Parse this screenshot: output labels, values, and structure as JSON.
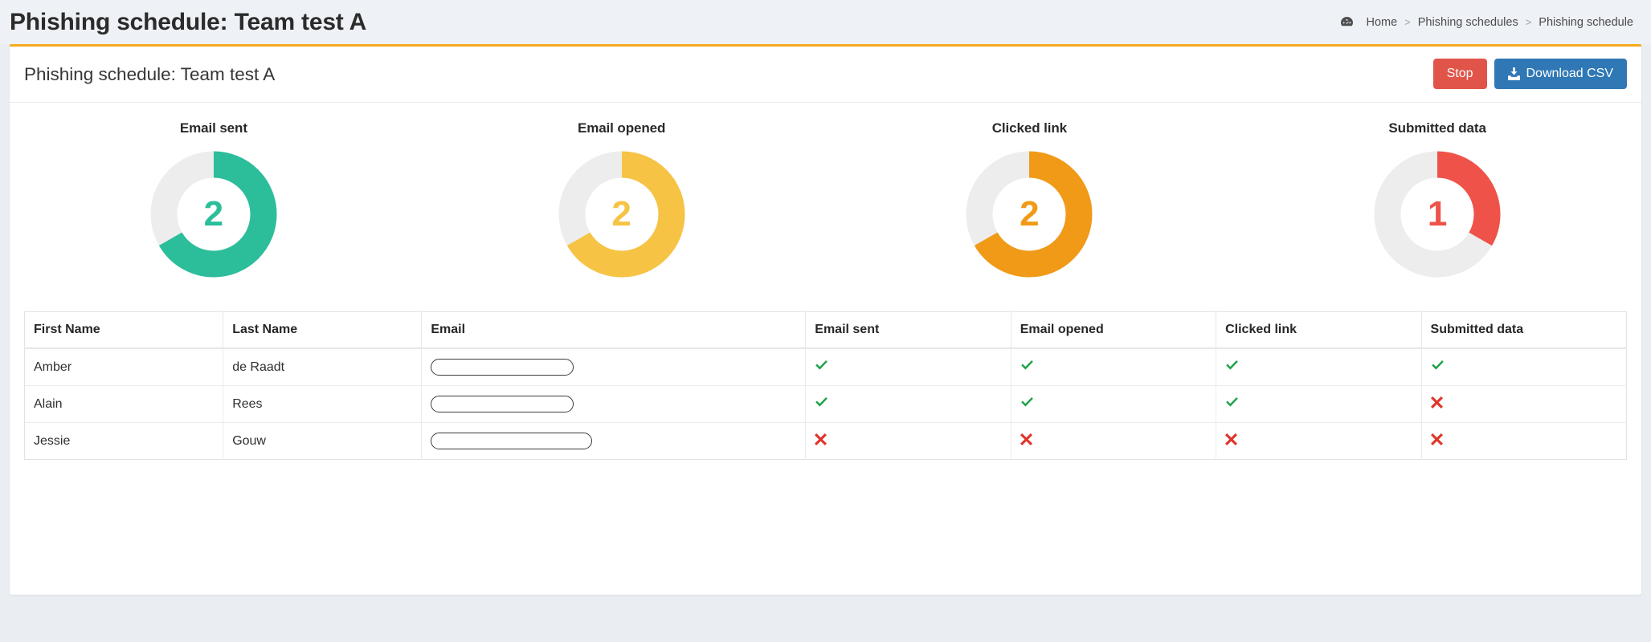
{
  "topbar": {
    "title": "Phishing schedule: Team test A",
    "breadcrumb": {
      "home_icon": "dashboard-icon",
      "items": [
        "Home",
        "Phishing schedules",
        "Phishing schedule"
      ],
      "separator": ">"
    }
  },
  "card": {
    "title": "Phishing schedule: Team test A",
    "accent_color": "#f4ab1c",
    "actions": {
      "stop_label": "Stop",
      "stop_color": "#e1544a",
      "download_label": "Download CSV",
      "download_color": "#2f77b5",
      "download_icon": "download-icon"
    }
  },
  "chart_data": [
    {
      "type": "pie",
      "title": "Email sent",
      "value": 2,
      "total": 3,
      "percent": 66.7,
      "color": "#2cbe9b",
      "track_color": "#ededed"
    },
    {
      "type": "pie",
      "title": "Email opened",
      "value": 2,
      "total": 3,
      "percent": 66.7,
      "color": "#f6c344",
      "track_color": "#ededed"
    },
    {
      "type": "pie",
      "title": "Clicked link",
      "value": 2,
      "total": 3,
      "percent": 66.7,
      "color": "#f09a18",
      "track_color": "#ededed"
    },
    {
      "type": "pie",
      "title": "Submitted data",
      "value": 1,
      "total": 3,
      "percent": 33.3,
      "color": "#ee5249",
      "track_color": "#ededed"
    }
  ],
  "table": {
    "columns": [
      "First Name",
      "Last Name",
      "Email",
      "Email sent",
      "Email opened",
      "Clicked link",
      "Submitted data"
    ],
    "rows": [
      {
        "first_name": "Amber",
        "last_name": "de Raadt",
        "email": "",
        "email_sent": true,
        "email_opened": true,
        "clicked_link": true,
        "submitted_data": true
      },
      {
        "first_name": "Alain",
        "last_name": "Rees",
        "email": "",
        "email_sent": true,
        "email_opened": true,
        "clicked_link": true,
        "submitted_data": false
      },
      {
        "first_name": "Jessie",
        "last_name": "Gouw",
        "email": "",
        "email_sent": false,
        "email_opened": false,
        "clicked_link": false,
        "submitted_data": false
      }
    ],
    "check_color": "#1ea34a",
    "cross_color": "#e0352b"
  }
}
